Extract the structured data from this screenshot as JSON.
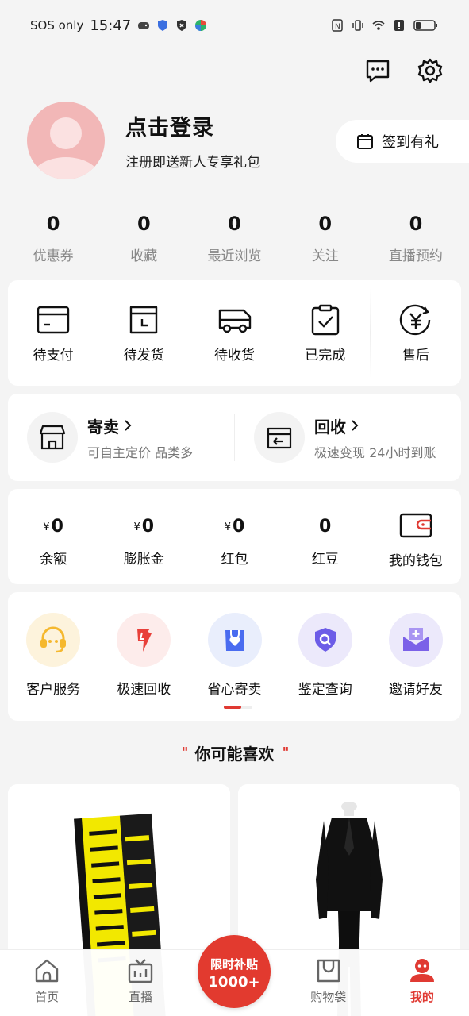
{
  "status_bar": {
    "carrier": "SOS only",
    "time": "15:47"
  },
  "profile": {
    "title": "点击登录",
    "subtitle": "注册即送新人专享礼包"
  },
  "signin": {
    "label": "签到有礼"
  },
  "stats": [
    {
      "num": "0",
      "label": "优惠券"
    },
    {
      "num": "0",
      "label": "收藏"
    },
    {
      "num": "0",
      "label": "最近浏览"
    },
    {
      "num": "0",
      "label": "关注"
    },
    {
      "num": "0",
      "label": "直播预约"
    }
  ],
  "orders": [
    {
      "label": "待支付",
      "icon": "card-icon"
    },
    {
      "label": "待发货",
      "icon": "box-clock-icon"
    },
    {
      "label": "待收货",
      "icon": "truck-icon"
    },
    {
      "label": "已完成",
      "icon": "clipboard-check-icon"
    },
    {
      "label": "售后",
      "icon": "yen-refund-icon"
    }
  ],
  "trade": [
    {
      "title": "寄卖",
      "sub": "可自主定价 品类多",
      "icon": "store-icon"
    },
    {
      "title": "回收",
      "sub": "极速变现 24小时到账",
      "icon": "recycle-box-icon"
    }
  ],
  "wallet": {
    "yen": "¥",
    "items": [
      {
        "value": "0",
        "label": "余额"
      },
      {
        "value": "0",
        "label": "膨胀金"
      },
      {
        "value": "0",
        "label": "红包"
      },
      {
        "value": "0",
        "label": "红豆"
      }
    ],
    "my_wallet": "我的钱包"
  },
  "services": [
    {
      "label": "客户服务",
      "icon": "headset-icon",
      "bg": "#fdf3dc",
      "color": "#f5b82e"
    },
    {
      "label": "极速回收",
      "icon": "lightning-icon",
      "bg": "#fdeceb",
      "color": "#e8403a"
    },
    {
      "label": "省心寄卖",
      "icon": "heart-bag-icon",
      "bg": "#e9eefc",
      "color": "#4a6cf0"
    },
    {
      "label": "鉴定查询",
      "icon": "shield-search-icon",
      "bg": "#ece9fb",
      "color": "#6c5ce7"
    },
    {
      "label": "邀请好友",
      "icon": "invite-mail-icon",
      "bg": "#ece9fb",
      "color": "#7b61e8"
    }
  ],
  "recommend": {
    "title": "你可能喜欢"
  },
  "tabbar": {
    "items": [
      {
        "label": "首页"
      },
      {
        "label": "直播"
      },
      {
        "label": "购物袋"
      },
      {
        "label": "我的"
      }
    ],
    "promo_line1": "限时补贴",
    "promo_line2": "1000+"
  },
  "colors": {
    "accent": "#e03a33",
    "background": "#f4f4f4"
  }
}
